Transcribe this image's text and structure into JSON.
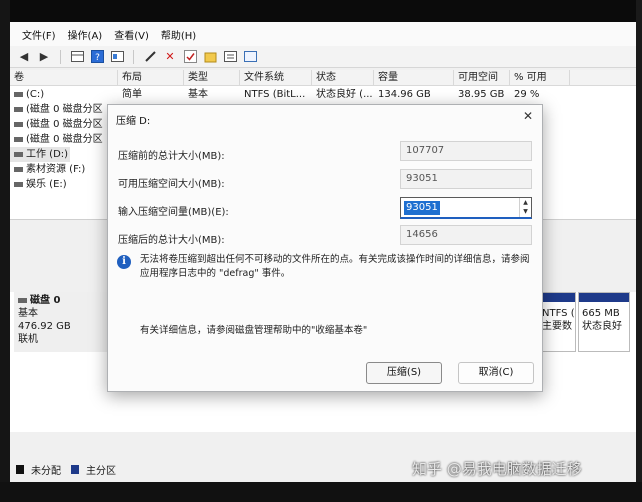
{
  "menubar": [
    "文件(F)",
    "操作(A)",
    "查看(V)",
    "帮助(H)"
  ],
  "toolbar_icons": [
    "back-arrow-icon",
    "forward-arrow-icon",
    "volume-view-icon",
    "help-icon",
    "properties-icon",
    "wand-icon",
    "delete-icon",
    "check-icon",
    "new-folder-icon",
    "details-icon",
    "list-icon"
  ],
  "volume_table": {
    "columns": [
      "卷",
      "布局",
      "类型",
      "文件系统",
      "状态",
      "容量",
      "可用空间",
      "% 可用"
    ],
    "rows": [
      [
        "(C:)",
        "简单",
        "基本",
        "NTFS (BitL...",
        "状态良好 (...",
        "134.96 GB",
        "38.95 GB",
        "29 %"
      ],
      [
        "(磁盘 0 磁盘分区",
        "",
        "",
        "",
        "",
        "",
        "",
        ""
      ],
      [
        "(磁盘 0 磁盘分区",
        "",
        "",
        "",
        "",
        "",
        "",
        ""
      ],
      [
        "(磁盘 0 磁盘分区",
        "",
        "",
        "",
        "",
        "",
        "",
        ""
      ],
      [
        "工作 (D:)",
        "",
        "",
        "",
        "",
        "",
        "",
        ""
      ],
      [
        "素材资源 (F:)",
        "",
        "",
        "",
        "",
        "",
        "",
        ""
      ],
      [
        "娱乐 (E:)",
        "",
        "",
        "",
        "",
        "",
        "",
        ""
      ]
    ]
  },
  "disk_map": {
    "disk_name": "磁盘 0",
    "disk_type": "基本",
    "disk_size": "476.92 GB",
    "disk_status": "联机",
    "partitions": [
      {
        "line1": "NTFS (",
        "line2": "主要数"
      },
      {
        "line1": "665 MB",
        "line2": "状态良好"
      }
    ]
  },
  "legend": [
    "未分配",
    "主分区"
  ],
  "dialog": {
    "title": "压缩 D:",
    "close_glyph": "✕",
    "before_label": "压缩前的总计大小(MB):",
    "before_value": "107707",
    "available_label": "可用压缩空间大小(MB):",
    "available_value": "93051",
    "input_label": "输入压缩空间量(MB)(E):",
    "input_value": "93051",
    "after_label": "压缩后的总计大小(MB):",
    "after_value": "14656",
    "info_text": "无法将卷压缩到超出任何不可移动的文件所在的点。有关完成该操作时间的详细信息，请参阅应用程序日志中的 \"defrag\" 事件。",
    "more_info": "有关详细信息，请参阅磁盘管理帮助中的\"收缩基本卷\"",
    "shrink_button": "压缩(S)",
    "cancel_button": "取消(C)"
  },
  "watermark": "知乎 @易我电脑数据迁移",
  "colors": {
    "primary_partition": "#1e3a8a",
    "unallocated": "#111111",
    "selection": "#1e6fd0"
  }
}
